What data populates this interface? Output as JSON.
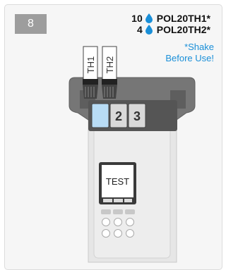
{
  "step": {
    "number": "8"
  },
  "reagents": [
    {
      "count": "10",
      "name": "POL20TH1*"
    },
    {
      "count": "4",
      "name": "POL20TH2*"
    }
  ],
  "note": {
    "line1": "*Shake",
    "line2": "Before Use!"
  },
  "tubes": [
    "TH1",
    "TH2"
  ],
  "cells": [
    "",
    "2",
    "3"
  ],
  "display": {
    "text": "TEST"
  },
  "colors": {
    "accent": "#1a8fd8",
    "cell_highlight": "#b8dcf5",
    "device": "#e5e5e5"
  }
}
